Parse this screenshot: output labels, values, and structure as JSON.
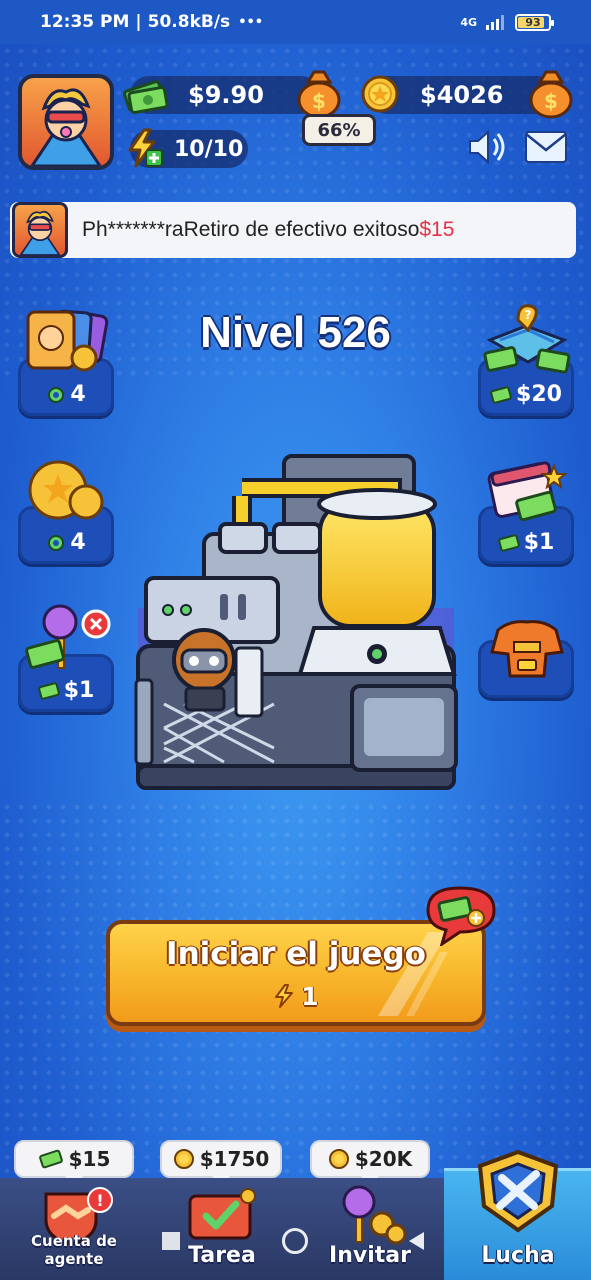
{
  "status_bar": {
    "time": "12:35 PM",
    "speed": "50.8kB/s",
    "more": "•••",
    "network": "4G",
    "battery": "93"
  },
  "header": {
    "cash": "$9.90",
    "coins": "$4026",
    "percent": "66%",
    "energy": "10/10"
  },
  "notice": {
    "user": "Ph*******ra",
    "message": "Retiro de efectivo exitoso",
    "amount": "$15"
  },
  "level_title": "Nivel 526",
  "left_tiles": [
    {
      "icon": "cards-icon",
      "value": "4"
    },
    {
      "icon": "gold-coins-icon",
      "value": "4"
    },
    {
      "icon": "lollipop-cash-icon",
      "value": "$1"
    }
  ],
  "right_tiles": [
    {
      "icon": "map-cash-icon",
      "value": "$20"
    },
    {
      "icon": "calendar-cash-icon",
      "value": "$1"
    },
    {
      "icon": "armor-icon",
      "value": ""
    }
  ],
  "start_button": {
    "label": "Iniciar el juego",
    "cost": "1"
  },
  "bottom_rewards": [
    "$15",
    "$1750",
    "$20K"
  ],
  "bottom_tabs": [
    "Cuenta de agente",
    "Tarea",
    "Invitar",
    "Lucha"
  ],
  "colors": {
    "background": "#2f7fe6",
    "start_button": "#f7b52a",
    "notice_amount": "#e63244",
    "active_tab": "#3aa3e8"
  }
}
